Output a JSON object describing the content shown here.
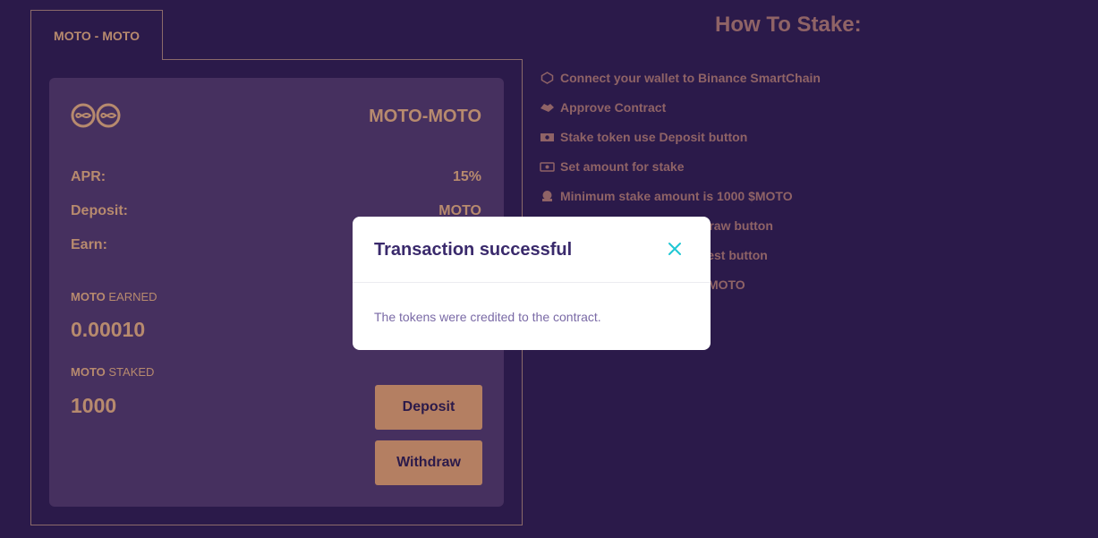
{
  "tab": {
    "label": "MOTO - MOTO"
  },
  "pool": {
    "pair": "MOTO-MOTO",
    "apr_label": "APR:",
    "apr_value": "15%",
    "deposit_label": "Deposit:",
    "deposit_value": "MOTO",
    "earn_label": "Earn:",
    "earned_token": "MOTO",
    "earned_suffix": " EARNED",
    "earned_value": "0.00010",
    "staked_token": "MOTO",
    "staked_suffix": " STAKED",
    "staked_value": "1000",
    "deposit_button": "Deposit",
    "withdraw_button": "Withdraw"
  },
  "how_to": {
    "title": "How To Stake:",
    "steps": [
      {
        "icon": "binance-icon",
        "text": "Connect your wallet to Binance SmartChain"
      },
      {
        "icon": "handshake-icon",
        "text": "Approve Contract"
      },
      {
        "icon": "money-icon",
        "text": "Stake token use Deposit button"
      },
      {
        "icon": "banknote-icon",
        "text": "Set amount for stake"
      },
      {
        "icon": "coin-stack-icon",
        "text": "Minimum stake amount is 1000 $MOTO"
      },
      {
        "icon": "unstake-icon",
        "text": "Unstake token use Withdraw button"
      },
      {
        "icon": "harvest-icon",
        "text": "Harvest reward use Harvest button"
      },
      {
        "icon": "min-unstake-icon",
        "text": "Minimum unstake is 10 $MOTO"
      }
    ]
  },
  "modal": {
    "title": "Transaction successful",
    "message": "The tokens were credited to the contract."
  },
  "colors": {
    "background": "#2b1a4a",
    "card": "#46305f",
    "accent": "#b78a6e",
    "button": "#b47f62",
    "close": "#1fc7d4"
  }
}
